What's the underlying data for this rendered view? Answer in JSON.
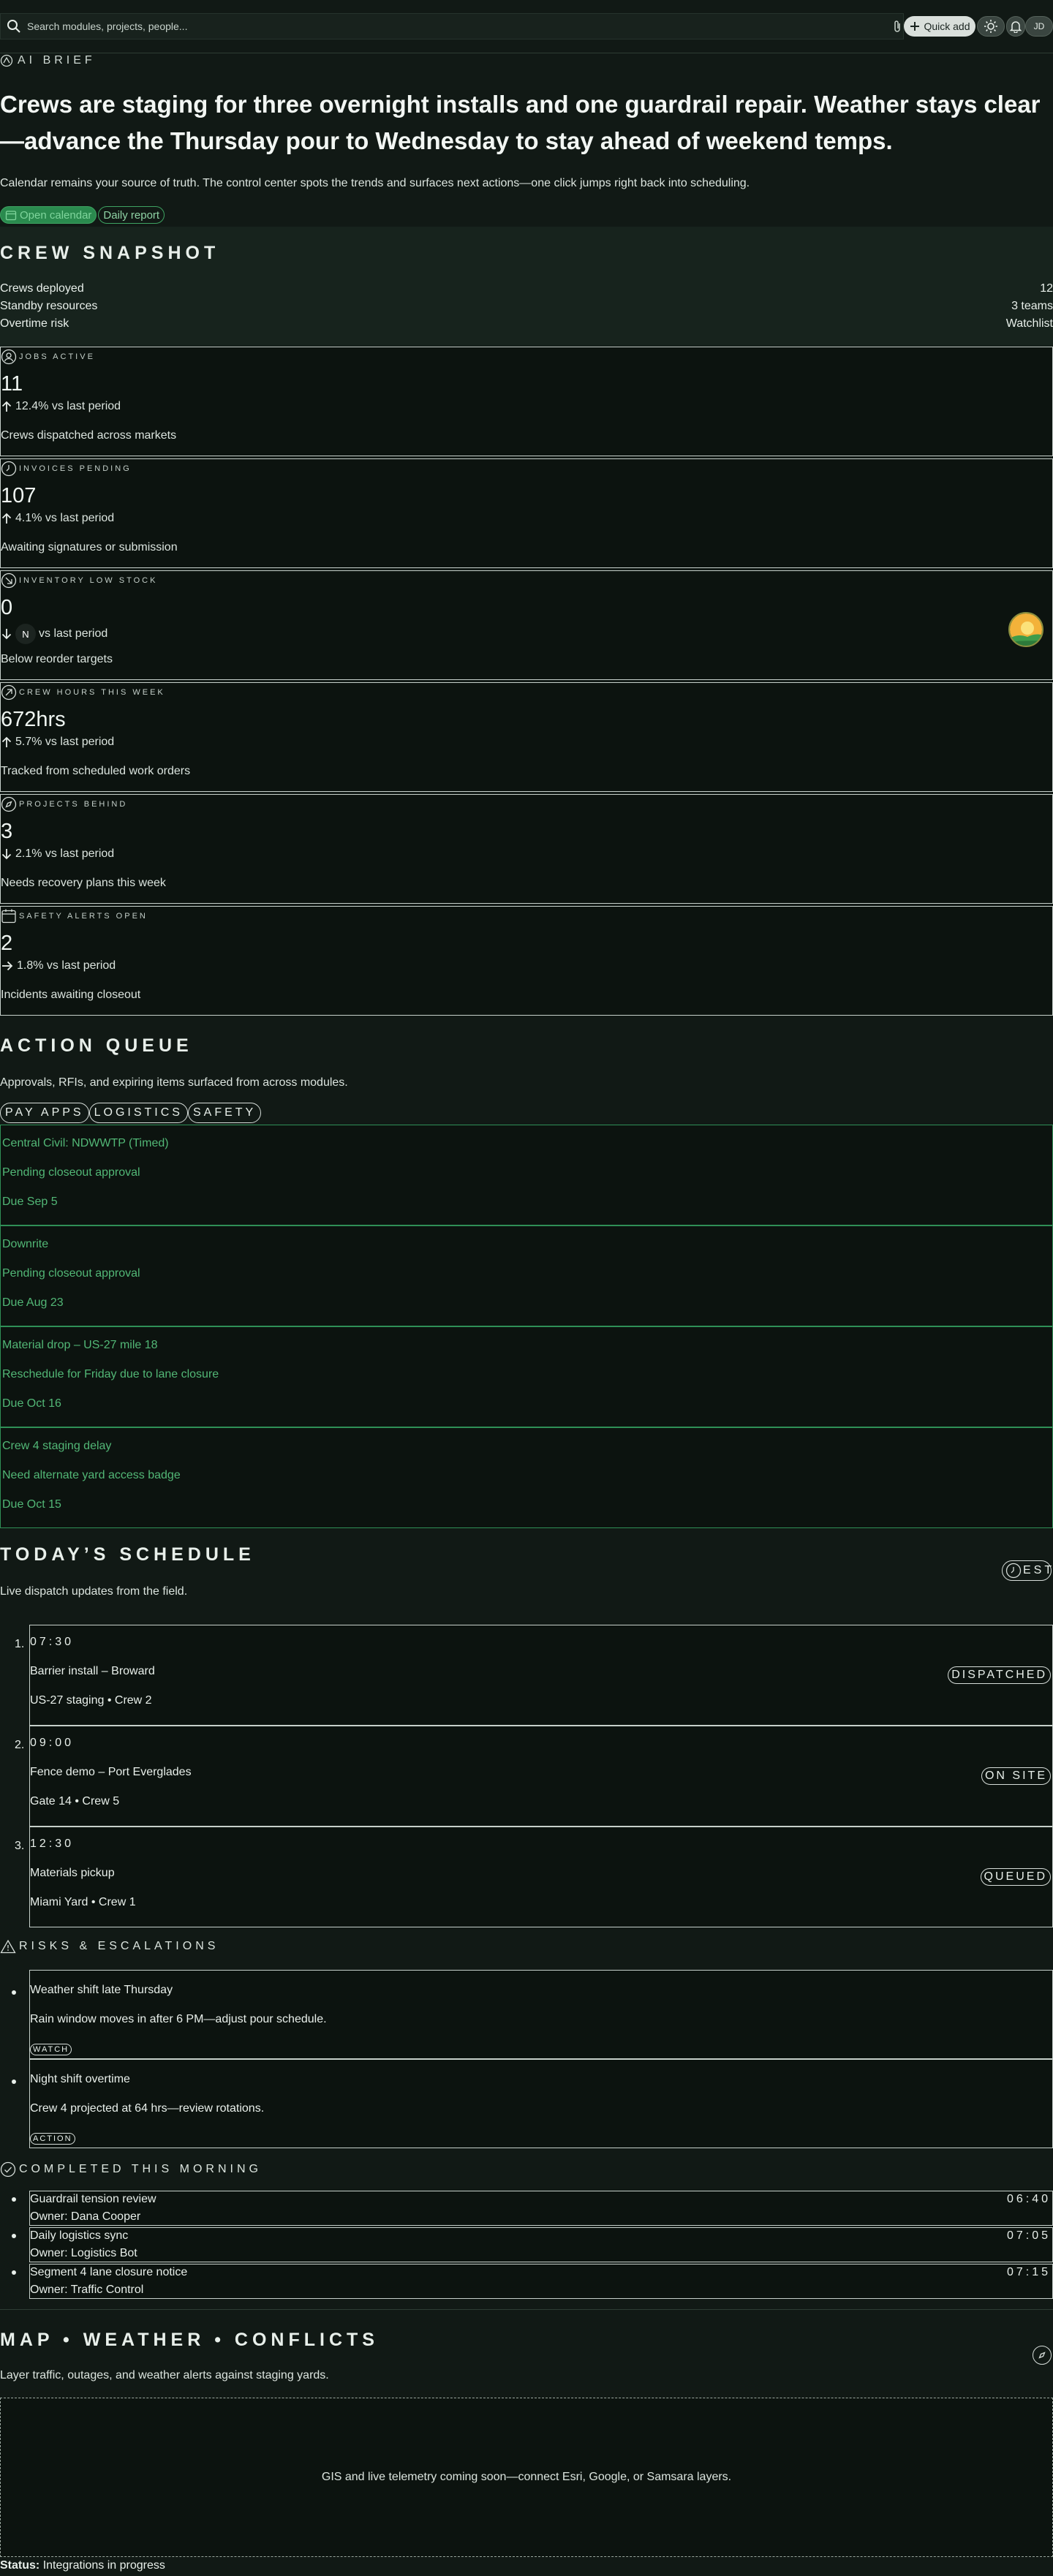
{
  "header": {
    "search_placeholder": "Search modules, projects, people...",
    "quick_add_label": "Quick add",
    "avatar_initials": "JD"
  },
  "brief": {
    "label": "AI BRIEF",
    "headline": "Crews are staging for three overnight installs and one guardrail repair. Weather stays clear—advance the Thursday pour to Wednesday to stay ahead of weekend temps.",
    "subtitle": "Calendar remains your source of truth. The control center spots the trends and surfaces next actions—one click jumps right back into scheduling.",
    "open_calendar_label": "Open calendar",
    "daily_report_label": "Daily report"
  },
  "snapshot": {
    "title": "CREW SNAPSHOT",
    "rows": [
      {
        "label": "Crews deployed",
        "value": "12"
      },
      {
        "label": "Standby resources",
        "value": "3 teams"
      },
      {
        "label": "Overtime risk",
        "value": "Watchlist"
      }
    ]
  },
  "metrics": [
    {
      "label": "JOBS ACTIVE",
      "value": "11",
      "delta": "12.4% vs last period",
      "note": "Crews dispatched across markets",
      "icon": "user-icon",
      "trend": "up"
    },
    {
      "label": "INVOICES PENDING",
      "value": "107",
      "delta": "4.1% vs last period",
      "note": "Awaiting signatures or submission",
      "icon": "clock-icon",
      "trend": "up"
    },
    {
      "label": "INVENTORY LOW STOCK",
      "value": "0",
      "delta": "vs last period",
      "note": "Below reorder targets",
      "icon": "arrow-down-right-icon",
      "trend": "down",
      "badge": "N"
    },
    {
      "label": "CREW HOURS THIS WEEK",
      "value": "672hrs",
      "delta": "5.7% vs last period",
      "note": "Tracked from scheduled work orders",
      "icon": "arrow-up-right-icon",
      "trend": "up"
    },
    {
      "label": "PROJECTS BEHIND",
      "value": "3",
      "delta": "2.1% vs last period",
      "note": "Needs recovery plans this week",
      "icon": "compass-icon",
      "trend": "down"
    },
    {
      "label": "SAFETY ALERTS OPEN",
      "value": "2",
      "delta": "1.8% vs last period",
      "note": "Incidents awaiting closeout",
      "icon": "calendar-icon",
      "trend": "right"
    }
  ],
  "action_queue": {
    "title": "ACTION QUEUE",
    "subtitle": "Approvals, RFIs, and expiring items surfaced from across modules.",
    "tabs": [
      "PAY APPS",
      "LOGISTICS",
      "SAFETY"
    ],
    "items": [
      {
        "title": "Central Civil: NDWWTP (Timed)",
        "detail": "Pending closeout approval",
        "due": "Due Sep 5"
      },
      {
        "title": "Downrite",
        "detail": "Pending closeout approval",
        "due": "Due Aug 23"
      },
      {
        "title": "Material drop – US-27 mile 18",
        "detail": "Reschedule for Friday due to lane closure",
        "due": "Due Oct 16"
      },
      {
        "title": "Crew 4 staging delay",
        "detail": "Need alternate yard access badge",
        "due": "Due Oct 15"
      }
    ]
  },
  "schedule": {
    "title": "TODAY’S SCHEDULE",
    "subtitle": "Live dispatch updates from the field.",
    "timezone": "EST",
    "items": [
      {
        "num": "1.",
        "time": "07:30",
        "job": "Barrier install – Broward",
        "location": "US-27 staging • Crew 2",
        "status": "DISPATCHED"
      },
      {
        "num": "2.",
        "time": "09:00",
        "job": "Fence demo – Port Everglades",
        "location": "Gate 14 • Crew 5",
        "status": "ON SITE"
      },
      {
        "num": "3.",
        "time": "12:30",
        "job": "Materials pickup",
        "location": "Miami Yard • Crew 1",
        "status": "QUEUED"
      }
    ]
  },
  "risks": {
    "title": "RISKS & ESCALATIONS",
    "items": [
      {
        "title": "Weather shift late Thursday",
        "detail": "Rain window moves in after 6 PM—adjust pour schedule.",
        "tag": "WATCH"
      },
      {
        "title": "Night shift overtime",
        "detail": "Crew 4 projected at 64 hrs—review rotations.",
        "tag": "ACTION"
      }
    ]
  },
  "completed": {
    "title": "COMPLETED THIS MORNING",
    "items": [
      {
        "title": "Guardrail tension review",
        "owner": "Owner: Dana Cooper",
        "time": "06:40"
      },
      {
        "title": "Daily logistics sync",
        "owner": "Owner: Logistics Bot",
        "time": "07:05"
      },
      {
        "title": "Segment 4 lane closure notice",
        "owner": "Owner: Traffic Control",
        "time": "07:15"
      }
    ]
  },
  "map": {
    "title": "MAP • WEATHER • CONFLICTS",
    "subtitle": "Layer traffic, outages, and weather alerts against staging yards.",
    "placeholder": "GIS and live telemetry coming soon—connect Esri, Google, or Samsara layers."
  },
  "footer": {
    "status_label": "Status:",
    "status_value": "Integrations in progress"
  },
  "colors": {
    "background": "#111915",
    "accent": "#2f8f56",
    "accent_text": "#52b776"
  }
}
